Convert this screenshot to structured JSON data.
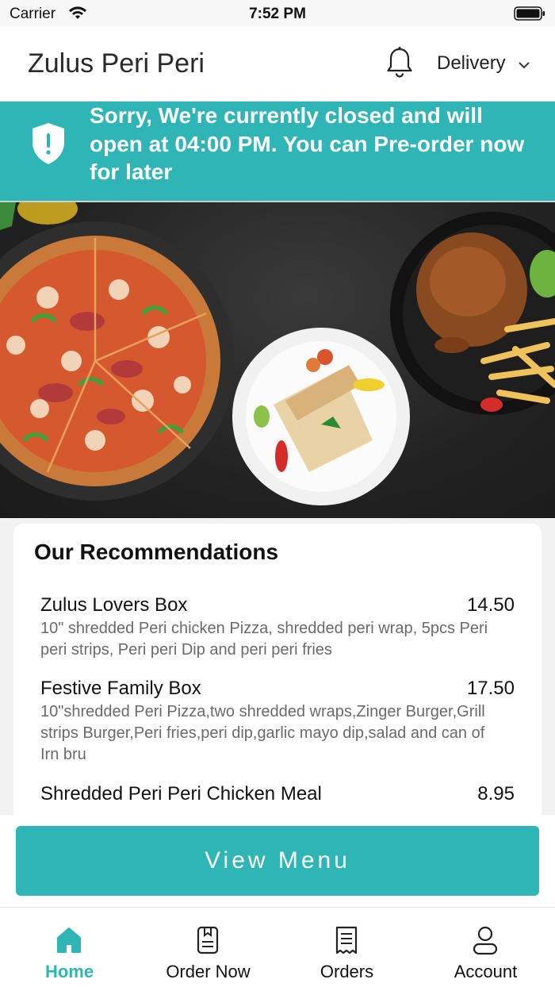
{
  "status_bar": {
    "carrier": "Carrier",
    "time": "7:52 PM"
  },
  "header": {
    "title": "Zulus Peri Peri",
    "delivery_label": "Delivery"
  },
  "banner": {
    "message": "Sorry, We're currently closed and will open at 04:00 PM. You can Pre-order now for later"
  },
  "recommendations": {
    "title": "Our Recommendations",
    "items": [
      {
        "name": "Zulus Lovers Box",
        "price": "14.50",
        "description": "10\" shredded Peri chicken Pizza, shredded peri wrap, 5pcs Peri peri strips, Peri peri Dip and peri peri fries"
      },
      {
        "name": "Festive Family Box",
        "price": "17.50",
        "description": "10\"shredded Peri Pizza,two shredded wraps,Zinger Burger,Grill strips Burger,Peri fries,peri dip,garlic mayo dip,salad and can of Irn bru"
      },
      {
        "name": "Shredded Peri Peri Chicken Meal",
        "price": "8.95",
        "description": ""
      }
    ]
  },
  "view_menu_label": "View Menu",
  "tabs": [
    {
      "label": "Home",
      "icon": "home-icon",
      "active": true
    },
    {
      "label": "Order Now",
      "icon": "order-now-icon",
      "active": false
    },
    {
      "label": "Orders",
      "icon": "receipt-icon",
      "active": false
    },
    {
      "label": "Account",
      "icon": "user-icon",
      "active": false
    }
  ],
  "colors": {
    "accent": "#2fb5b5",
    "banner_text": "#ffffff"
  }
}
